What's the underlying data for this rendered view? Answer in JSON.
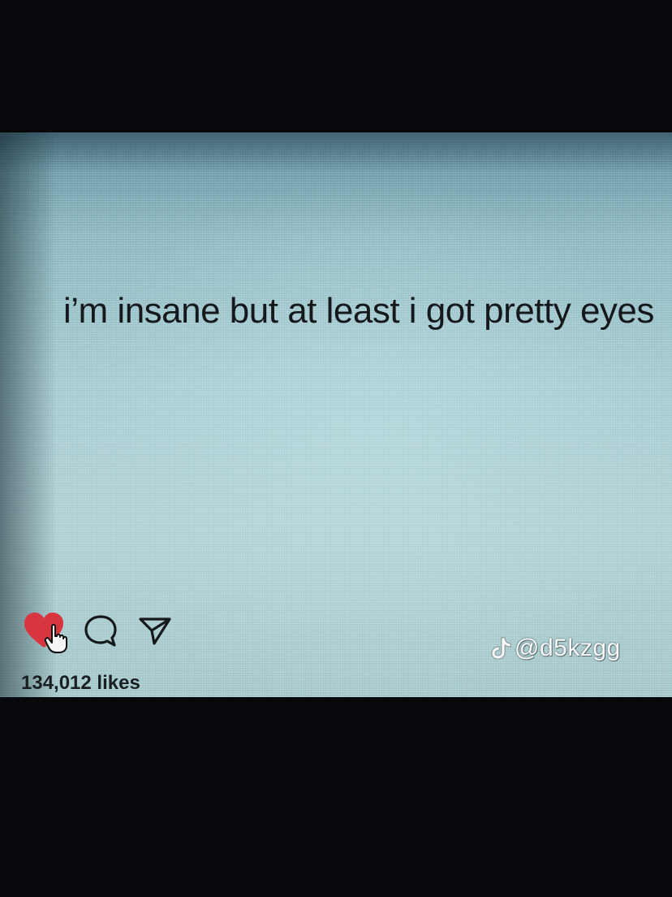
{
  "post": {
    "text": "i’m insane but at least i got pretty eyes"
  },
  "actions": {
    "like_icon": "heart-icon",
    "cursor_icon": "hand-pointer-icon",
    "comment_icon": "comment-bubble-icon",
    "share_icon": "send-icon",
    "liked": true,
    "like_color": "#d8363f"
  },
  "likes": {
    "label": "134,012 likes"
  },
  "watermark": {
    "logo_icon": "tiktok-note-icon",
    "handle": "@d5kzgg"
  },
  "colors": {
    "screen": "#a9d0d6",
    "text": "#15191c"
  }
}
